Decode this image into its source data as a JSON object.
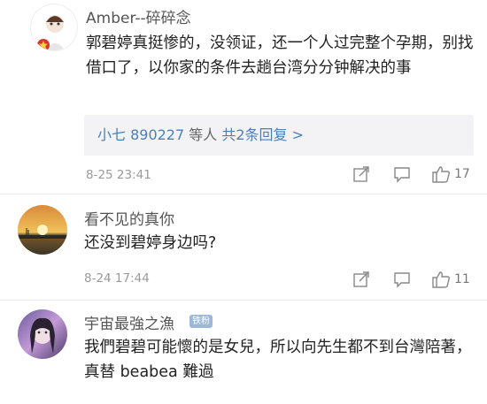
{
  "comments": [
    {
      "username": "Amber--碎碎念",
      "text": "郭碧婷真挺惨的，没领证，还一个人过完整个孕期，别找借口了，以你家的条件去趟台湾分分钟解决的事",
      "replies": {
        "names": "小七 890227",
        "joiner": " 等人 ",
        "count_label": "共2条回复 >"
      },
      "timestamp": "8-25 23:41",
      "likes": "17"
    },
    {
      "username": "看不见的真你",
      "text": "还没到碧婷身边吗?",
      "timestamp": "8-24 17:44",
      "likes": "11"
    },
    {
      "username": "宇宙最強之漁",
      "badge": "铁粉",
      "text": "我們碧碧可能懷的是女兒，所以向先生都不到台灣陪著，真替 beabea 難過"
    }
  ],
  "icons": {
    "share": "share-icon",
    "comment": "comment-icon",
    "like": "thumbs-up-icon"
  },
  "colors": {
    "link": "#4a7fb7",
    "username": "#555555",
    "meta": "#9a9a9a",
    "reply_bg": "#f3f3f5"
  }
}
